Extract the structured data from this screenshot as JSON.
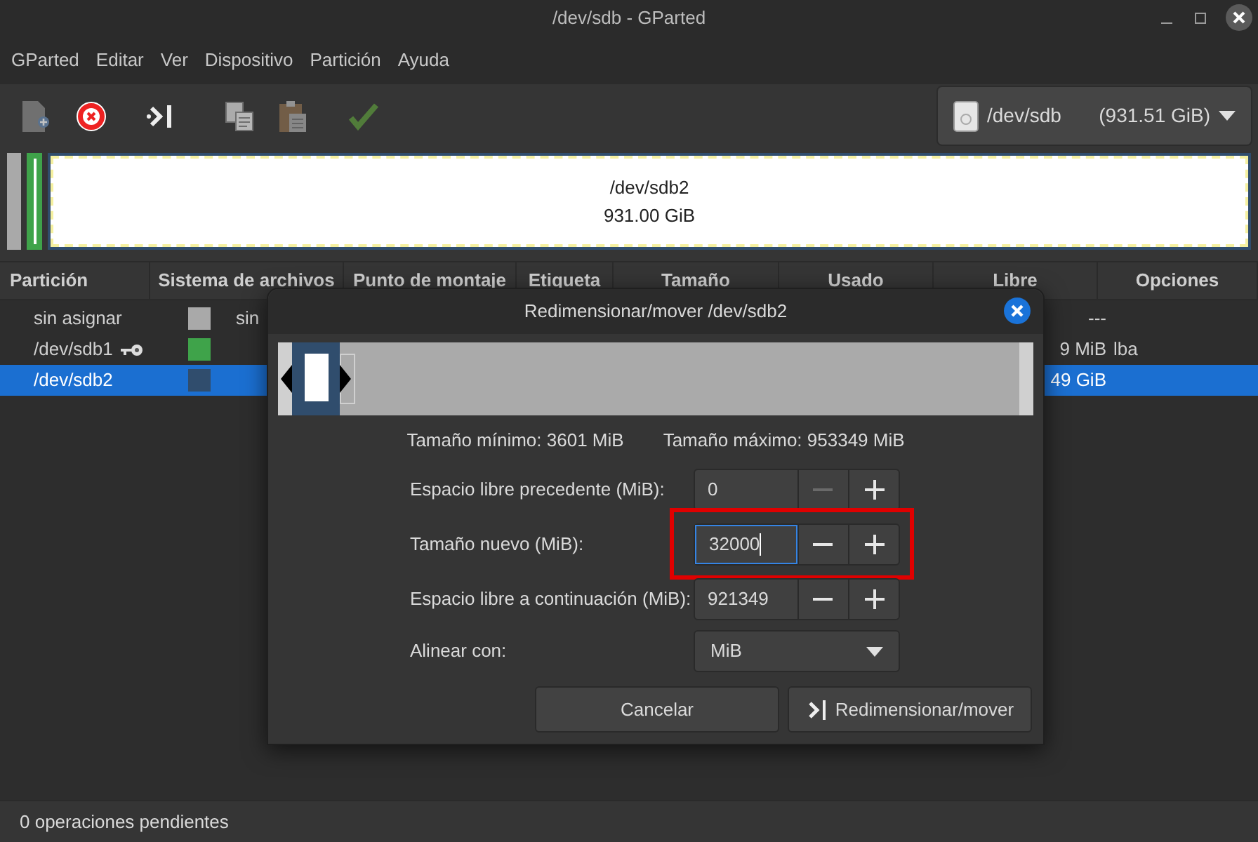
{
  "window": {
    "title": "/dev/sdb - GParted"
  },
  "menu": [
    "GParted",
    "Editar",
    "Ver",
    "Dispositivo",
    "Partición",
    "Ayuda"
  ],
  "toolbar": [
    {
      "kind": "new",
      "disabled": true
    },
    {
      "kind": "delete",
      "disabled": false
    },
    {
      "kind": "resize",
      "disabled": false
    },
    {
      "kind": "copy",
      "disabled": true
    },
    {
      "kind": "paste",
      "disabled": true
    },
    {
      "kind": "apply",
      "disabled": true
    }
  ],
  "device": {
    "name": "/dev/sdb",
    "size": "(931.51 GiB)"
  },
  "disk_map": {
    "label": "/dev/sdb2",
    "size": "931.00 GiB"
  },
  "table": {
    "columns": [
      "Partición",
      "Sistema de archivos",
      "Punto de montaje",
      "Etiqueta",
      "Tamaño",
      "Usado",
      "Libre",
      "Opciones"
    ],
    "rows": [
      {
        "name": "sin asignar",
        "color": "#a9a9a9",
        "filesystem": "sin",
        "free": "---",
        "options": "",
        "locked": false,
        "selected": false
      },
      {
        "name": "/dev/sdb1",
        "color": "#3fa34a",
        "filesystem": "",
        "free": "9 MiB",
        "options": "lba",
        "locked": true,
        "selected": false
      },
      {
        "name": "/dev/sdb2",
        "color": "#304d6d",
        "filesystem": "",
        "free": "49 GiB",
        "options": "",
        "locked": false,
        "selected": true
      }
    ]
  },
  "dialog": {
    "title": "Redimensionar/mover /dev/sdb2",
    "min": "Tamaño mínimo: 3601 MiB",
    "max": "Tamaño máximo: 953349 MiB",
    "fields": [
      {
        "label": "Espacio libre precedente (MiB):",
        "value": "0",
        "minus_disabled": true,
        "focused": false,
        "highlighted": false
      },
      {
        "label": "Tamaño nuevo (MiB):",
        "value": "32000",
        "minus_disabled": false,
        "focused": true,
        "highlighted": true
      },
      {
        "label": "Espacio libre a continuación (MiB):",
        "value": "921349",
        "minus_disabled": false,
        "focused": false,
        "highlighted": false
      }
    ],
    "align": {
      "label": "Alinear con:",
      "value": "MiB"
    },
    "buttons": [
      {
        "label": "Cancelar",
        "kind": "cancel"
      },
      {
        "label": "Redimensionar/mover",
        "kind": "resize"
      }
    ]
  },
  "status_bar": "0 operaciones pendientes"
}
